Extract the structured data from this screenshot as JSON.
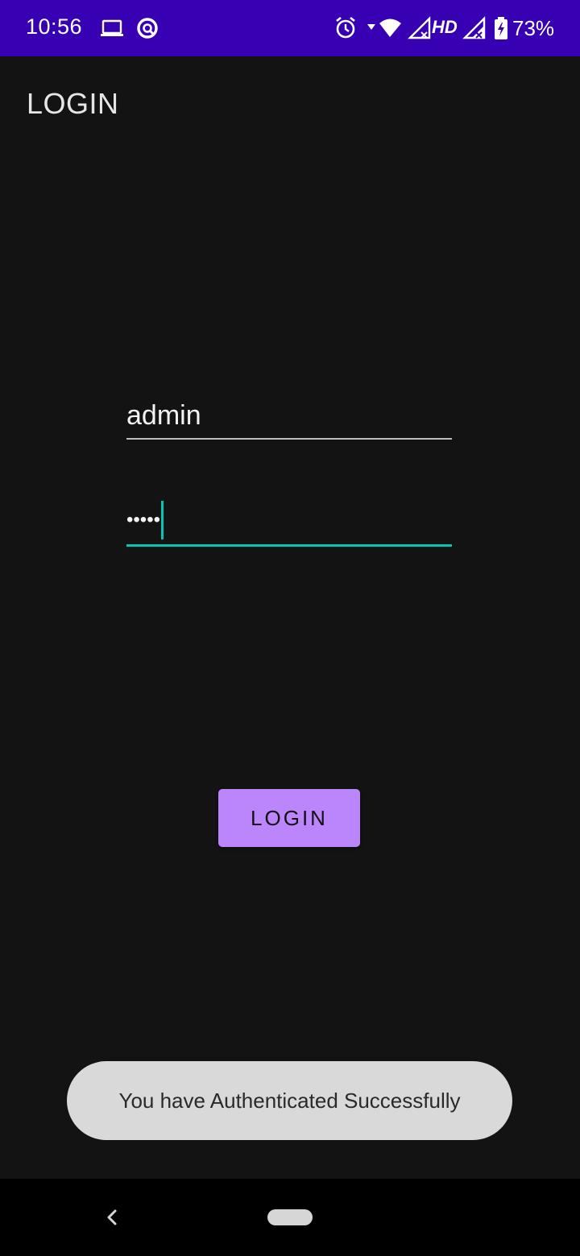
{
  "status_bar": {
    "time": "10:56",
    "network_label": "HD",
    "battery_percent": "73%",
    "wifi_badge": "4",
    "icons": [
      "laptop-icon",
      "data-saver-icon",
      "alarm-icon",
      "wifi-icon",
      "signal-icon",
      "signal-icon",
      "battery-charging-icon"
    ],
    "background_color": "#3700b3"
  },
  "app": {
    "title": "LOGIN",
    "username_value": "admin",
    "password_value": "•••••",
    "login_button_label": "LOGIN",
    "accent_color": "#03c7b4",
    "button_color": "#bb86fc"
  },
  "toast": {
    "message": "You have Authenticated Successfully"
  },
  "nav_bar": {
    "icons": [
      "back-icon",
      "home-pill-icon"
    ]
  }
}
